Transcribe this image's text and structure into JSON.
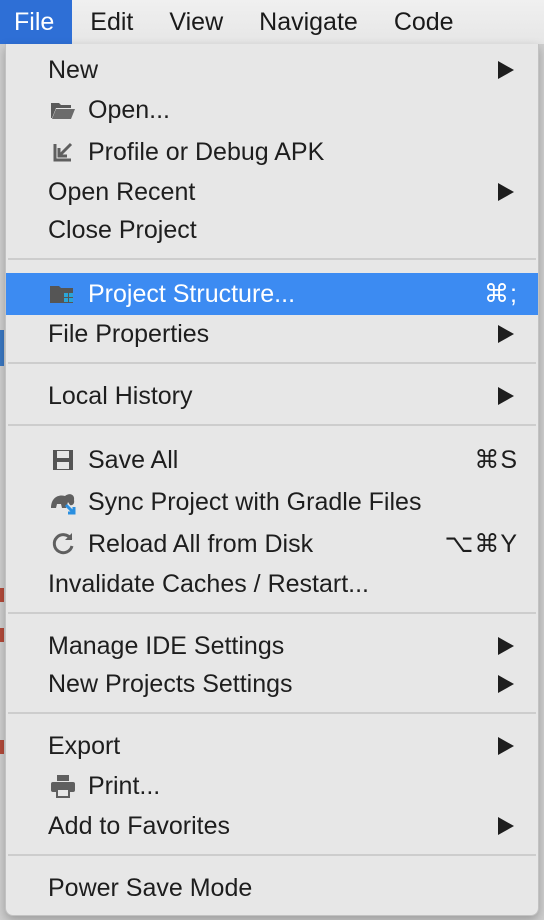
{
  "menubar": {
    "items": [
      "File",
      "Edit",
      "View",
      "Navigate",
      "Code"
    ]
  },
  "menu": {
    "new": "New",
    "open": "Open...",
    "profile_debug_apk": "Profile or Debug APK",
    "open_recent": "Open Recent",
    "close_project": "Close Project",
    "project_structure": "Project Structure...",
    "project_structure_shortcut": "⌘;",
    "file_properties": "File Properties",
    "local_history": "Local History",
    "save_all": "Save All",
    "save_all_shortcut": "⌘S",
    "sync_gradle": "Sync Project with Gradle Files",
    "reload_disk": "Reload All from Disk",
    "reload_disk_shortcut": "⌥⌘Y",
    "invalidate_caches": "Invalidate Caches / Restart...",
    "manage_ide_settings": "Manage IDE Settings",
    "new_projects_settings": "New Projects Settings",
    "export": "Export",
    "print": "Print...",
    "add_to_favorites": "Add to Favorites",
    "power_save_mode": "Power Save Mode"
  },
  "icons": {
    "open": "folder-open-icon",
    "profile": "arrow-in-icon",
    "project_structure": "project-structure-icon",
    "save": "floppy-disk-icon",
    "sync": "gradle-sync-icon",
    "reload": "reload-icon",
    "print": "printer-icon"
  },
  "colors": {
    "selection": "#3c8bf2",
    "menubar_active": "#2e6fd6",
    "menu_bg": "#e7e7e7"
  }
}
